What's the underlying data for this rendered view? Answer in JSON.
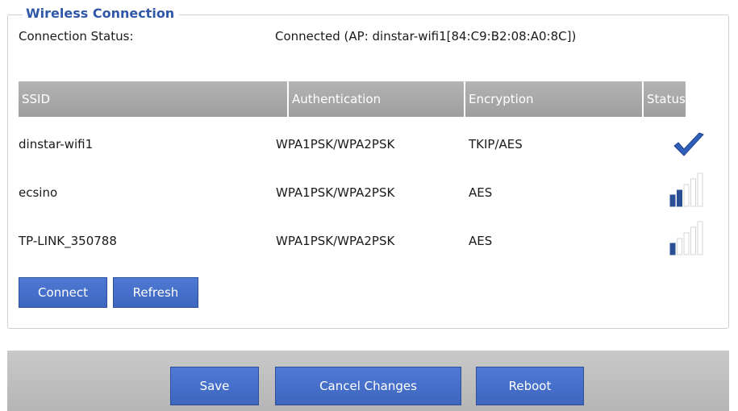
{
  "section": {
    "legend": "Wireless Connection",
    "status_label": "Connection Status:",
    "status_value": "Connected (AP: dinstar-wifi1[84:C9:B2:08:A0:8C])"
  },
  "table": {
    "headers": [
      "SSID",
      "Authentication",
      "Encryption",
      "Status"
    ],
    "rows": [
      {
        "ssid": "dinstar-wifi1",
        "auth": "WPA1PSK/WPA2PSK",
        "enc": "TKIP/AES",
        "status": "connected",
        "signal_bars": 0
      },
      {
        "ssid": "ecsino",
        "auth": "WPA1PSK/WPA2PSK",
        "enc": "AES",
        "status": "signal",
        "signal_bars": 2
      },
      {
        "ssid": "TP-LINK_350788",
        "auth": "WPA1PSK/WPA2PSK",
        "enc": "AES",
        "status": "signal",
        "signal_bars": 1
      }
    ]
  },
  "actions": {
    "connect_label": "Connect",
    "refresh_label": "Refresh"
  },
  "footer": {
    "save_label": "Save",
    "cancel_label": "Cancel Changes",
    "reboot_label": "Reboot"
  },
  "colors": {
    "accent": "#3e66bf",
    "legend": "#2f57a8",
    "signal_active": "#2b4f94",
    "signal_inactive": "#d6d6d6"
  }
}
